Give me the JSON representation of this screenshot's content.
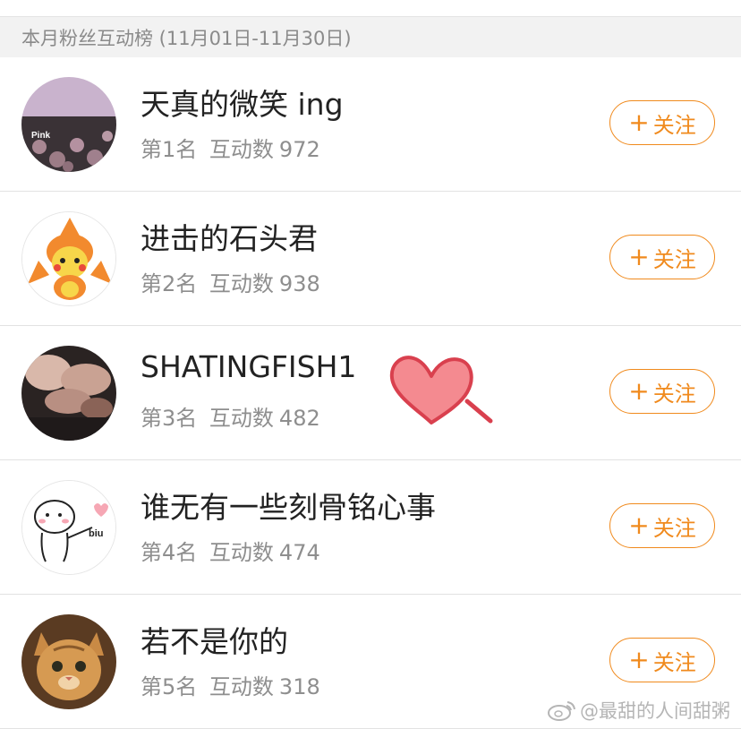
{
  "header": {
    "title": "本月粉丝互动榜 (11月01日-11月30日)"
  },
  "fans": [
    {
      "name": "天真的微笑 ing",
      "rank_label": "第1名",
      "interaction_label": "互动数",
      "count": "972",
      "avatar": "pink-flowers-avatar",
      "avatar_text": "Pink",
      "follow_plus": "+",
      "follow_label": "关注"
    },
    {
      "name": "进击的石头君",
      "rank_label": "第2名",
      "interaction_label": "互动数",
      "count": "938",
      "avatar": "pikachu-costume-avatar",
      "follow_plus": "+",
      "follow_label": "关注"
    },
    {
      "name": "SHATINGFISH1",
      "rank_label": "第3名",
      "interaction_label": "互动数",
      "count": "482",
      "avatar": "hands-photo-avatar",
      "follow_plus": "+",
      "follow_label": "关注"
    },
    {
      "name": "谁无有一些刻骨铭心事",
      "rank_label": "第4名",
      "interaction_label": "互动数",
      "count": "474",
      "avatar": "doodle-character-avatar",
      "avatar_text": "biu",
      "follow_plus": "+",
      "follow_label": "关注"
    },
    {
      "name": "若不是你的",
      "rank_label": "第5名",
      "interaction_label": "互动数",
      "count": "318",
      "avatar": "tabby-cat-avatar",
      "follow_plus": "+",
      "follow_label": "关注"
    }
  ],
  "watermark": {
    "text": "@最甜的人间甜粥",
    "icon": "weibo-icon"
  },
  "decoration": {
    "icon": "heart-icon"
  },
  "colors": {
    "accent": "#f08a1d",
    "header_bg": "#f2f2f2",
    "heart": "#f48a90"
  }
}
